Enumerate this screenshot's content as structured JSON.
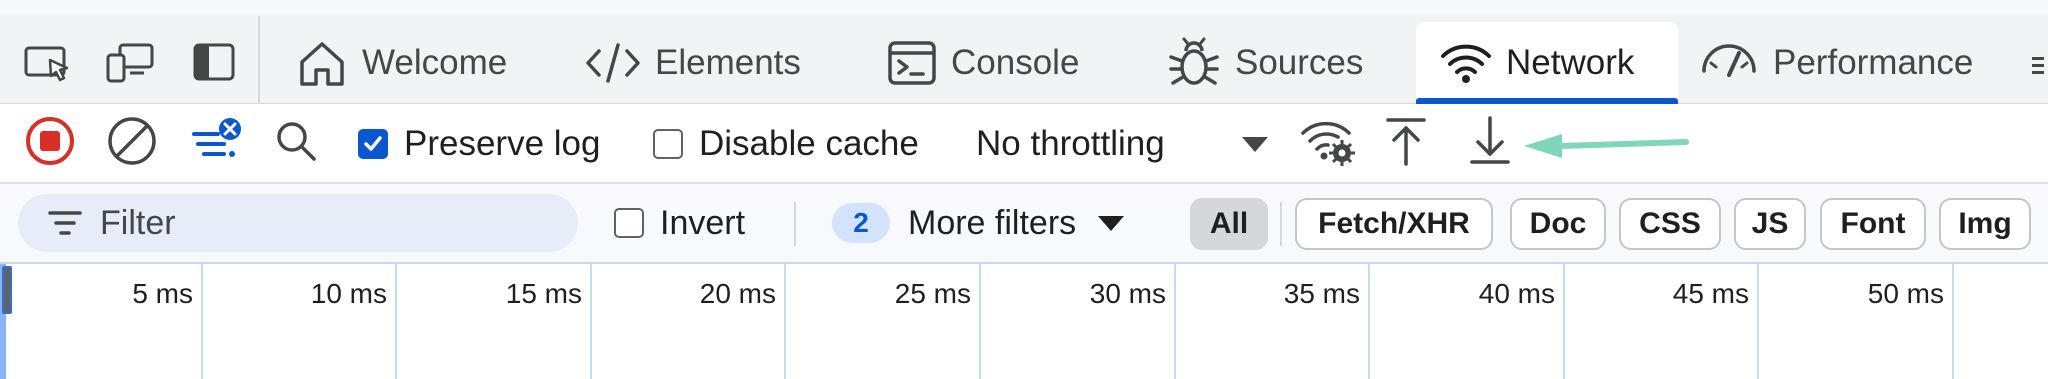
{
  "tabs": [
    {
      "label": "Welcome",
      "icon": "home-icon"
    },
    {
      "label": "Elements",
      "icon": "code-icon"
    },
    {
      "label": "Console",
      "icon": "console-icon"
    },
    {
      "label": "Sources",
      "icon": "bug-icon"
    },
    {
      "label": "Network",
      "icon": "wifi-icon",
      "active": true
    },
    {
      "label": "Performance",
      "icon": "gauge-icon"
    }
  ],
  "toolbar": {
    "preserve_log_label": "Preserve log",
    "preserve_log_checked": true,
    "disable_cache_label": "Disable cache",
    "disable_cache_checked": false,
    "throttling_value": "No throttling"
  },
  "filter": {
    "placeholder": "Filter",
    "invert_label": "Invert",
    "more_filters_count": "2",
    "more_filters_label": "More filters",
    "types": [
      "All",
      "Fetch/XHR",
      "Doc",
      "CSS",
      "JS",
      "Font",
      "Img"
    ],
    "selected_type": "All"
  },
  "timeline": {
    "ticks": [
      "5 ms",
      "10 ms",
      "15 ms",
      "20 ms",
      "25 ms",
      "30 ms",
      "35 ms",
      "40 ms",
      "45 ms",
      "50 ms"
    ]
  },
  "colors": {
    "accent": "#0b57d0",
    "record_red": "#d93025",
    "annotation_arrow": "#7fd6bb"
  }
}
